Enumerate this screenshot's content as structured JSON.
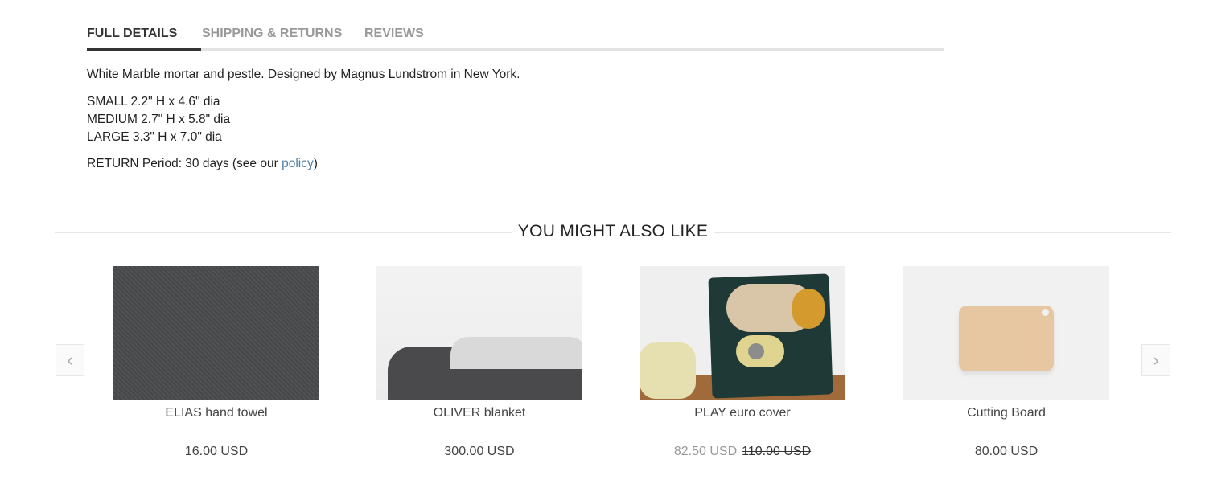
{
  "tabs": [
    {
      "label": "FULL DETAILS",
      "active": true
    },
    {
      "label": "SHIPPING & RETURNS",
      "active": false
    },
    {
      "label": "REVIEWS",
      "active": false
    }
  ],
  "details": {
    "description": "White Marble mortar and pestle. Designed by Magnus Lundstrom in New York.",
    "sizes": [
      "SMALL 2.2\" H x 4.6\" dia",
      "MEDIUM 2.7\" H x 5.8\" dia",
      "LARGE 3.3\" H x 7.0\" dia"
    ],
    "return_prefix": "RETURN Period: 30 days (see our ",
    "return_link": "policy",
    "return_suffix": ")"
  },
  "related": {
    "title": "YOU MIGHT ALSO LIKE",
    "prev_icon": "‹",
    "next_icon": "›",
    "products": [
      {
        "name": "ELIAS hand towel",
        "price": "16.00 USD"
      },
      {
        "name": "OLIVER blanket",
        "price": "300.00 USD"
      },
      {
        "name": "PLAY euro cover",
        "sale_price": "82.50 USD",
        "original_price": "110.00 USD"
      },
      {
        "name": "Cutting Board",
        "price": "80.00 USD"
      }
    ]
  },
  "colors": {
    "link": "#4f7ea4",
    "active_tab": "#333333",
    "inactive_tab": "#999999"
  }
}
